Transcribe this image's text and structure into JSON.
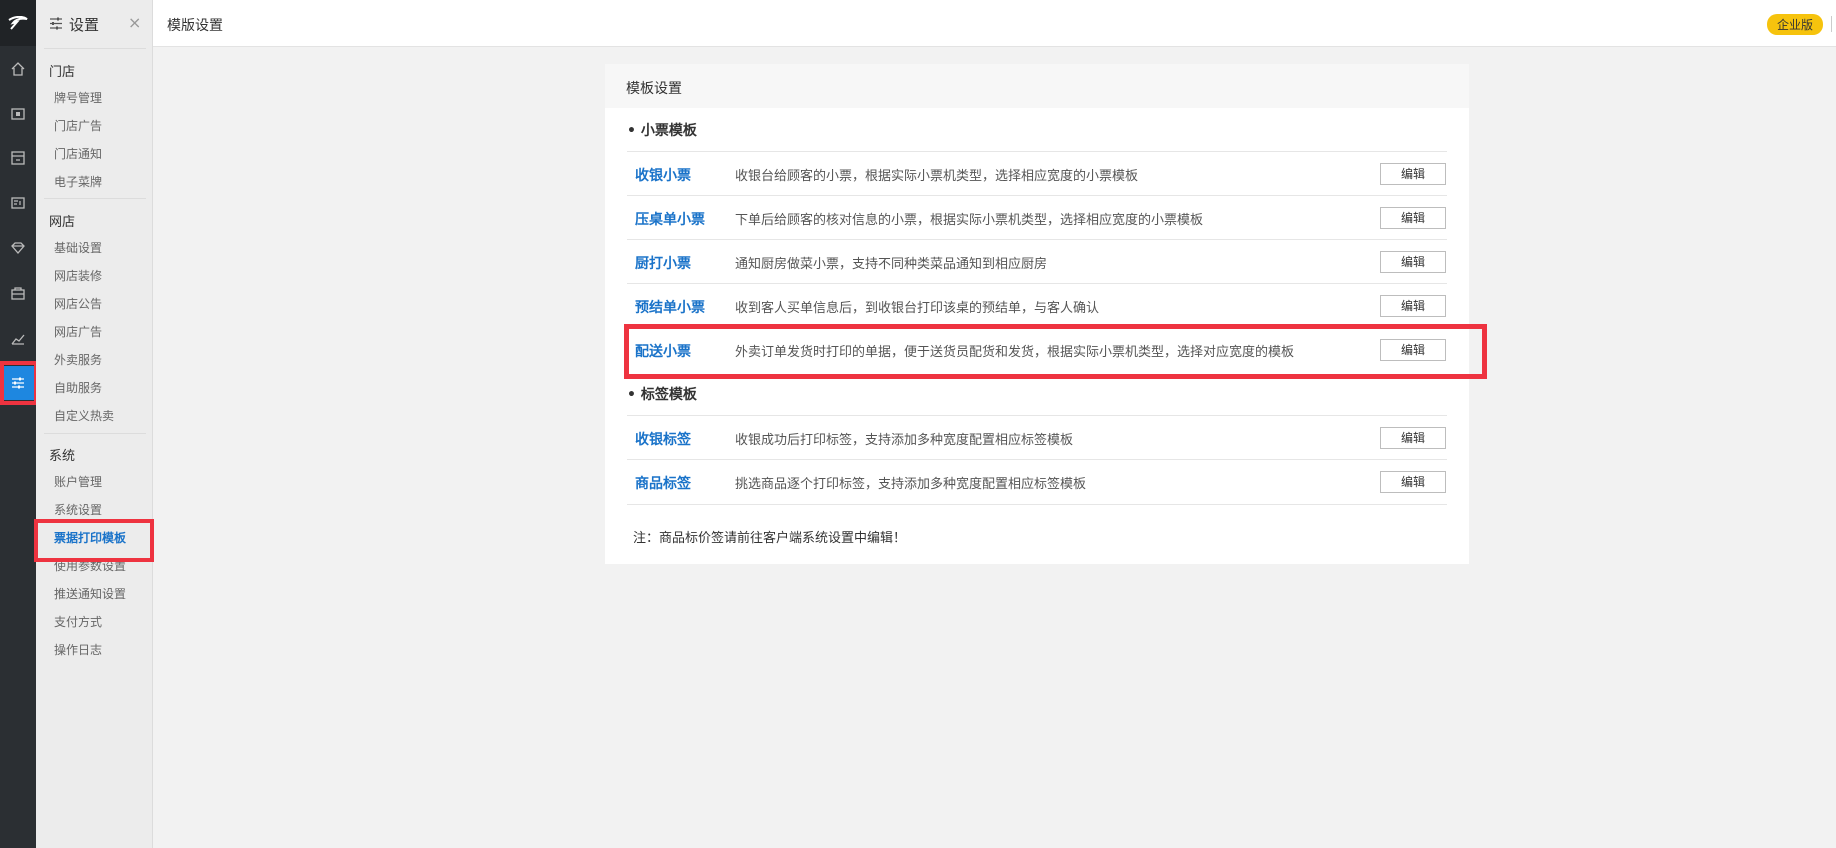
{
  "sidebar": {
    "title": "设置",
    "close_label": "×",
    "groups": [
      {
        "label": "门店",
        "items": [
          "牌号管理",
          "门店广告",
          "门店通知",
          "电子菜牌"
        ]
      },
      {
        "label": "网店",
        "items": [
          "基础设置",
          "网店装修",
          "网店公告",
          "网店广告",
          "外卖服务",
          "自助服务",
          "自定义热卖"
        ]
      },
      {
        "label": "系统",
        "items": [
          "账户管理",
          "系统设置",
          "票据打印模板",
          "使用参数设置",
          "推送通知设置",
          "支付方式",
          "操作日志"
        ]
      }
    ],
    "active_item": "票据打印模板"
  },
  "rail": {
    "icons": [
      "logo-icon",
      "home-icon",
      "wallet-icon",
      "store-icon",
      "member-card-icon",
      "diamond-icon",
      "bag-icon",
      "chart-icon",
      "settings-sliders-icon"
    ],
    "active_icon": "settings-sliders-icon"
  },
  "header": {
    "page_title": "模版设置",
    "edition_badge": "企业版"
  },
  "panel": {
    "title": "模板设置",
    "sections": [
      {
        "title": "• 小票模板",
        "rows": [
          {
            "name": "收银小票",
            "desc": "收银台给顾客的小票，根据实际小票机类型，选择相应宽度的小票模板",
            "button": "编辑"
          },
          {
            "name": "压桌单小票",
            "desc": "下单后给顾客的核对信息的小票，根据实际小票机类型，选择相应宽度的小票模板",
            "button": "编辑"
          },
          {
            "name": "厨打小票",
            "desc": "通知厨房做菜小票，支持不同种类菜品通知到相应厨房",
            "button": "编辑"
          },
          {
            "name": "预结单小票",
            "desc": "收到客人买单信息后，到收银台打印该桌的预结单，与客人确认",
            "button": "编辑"
          },
          {
            "name": "配送小票",
            "desc": "外卖订单发货时打印的单据，便于送货员配货和发货，根据实际小票机类型，选择对应宽度的模板",
            "button": "编辑"
          }
        ]
      },
      {
        "title": "• 标签模板",
        "rows": [
          {
            "name": "收银标签",
            "desc": "收银成功后打印标签，支持添加多种宽度配置相应标签模板",
            "button": "编辑"
          },
          {
            "name": "商品标签",
            "desc": "挑选商品逐个打印标签，支持添加多种宽度配置相应标签模板",
            "button": "编辑"
          }
        ]
      }
    ],
    "note": "注：商品标价签请前往客户端系统设置中编辑！"
  },
  "colors": {
    "rail_bg": "#2b2f33",
    "accent_blue": "#1a73c9",
    "active_rail": "#1e87e0",
    "highlight_red": "#ee3340",
    "badge_yellow": "#f6c30d"
  }
}
